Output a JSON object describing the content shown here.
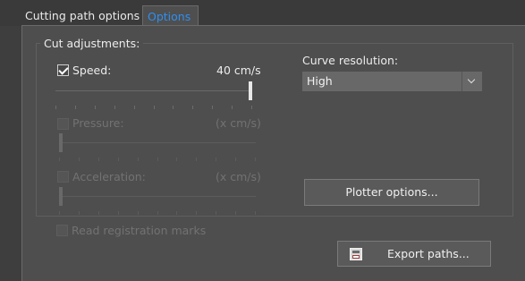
{
  "tabs": [
    {
      "label": "Cutting path options",
      "active": false
    },
    {
      "label": "Options",
      "active": true
    }
  ],
  "cut_adjustments": {
    "title": "Cut adjustments:",
    "speed": {
      "label": "Speed:",
      "value_text": "40 cm/s",
      "checked": true,
      "enabled": true,
      "slider_fraction": 1.0
    },
    "pressure": {
      "label": "Pressure:",
      "value_text": "(x cm/s)",
      "checked": false,
      "enabled": false,
      "slider_fraction": 0.0
    },
    "acceleration": {
      "label": "Acceleration:",
      "value_text": "(x cm/s)",
      "checked": false,
      "enabled": false,
      "slider_fraction": 0.0
    },
    "curve_resolution": {
      "label": "Curve resolution:",
      "selected": "High"
    },
    "plotter_options_label": "Plotter options..."
  },
  "read_registration_marks": {
    "label": "Read registration marks",
    "checked": false,
    "enabled": false
  },
  "export_paths": {
    "label": "Export paths...",
    "icon": "save-icon"
  },
  "colors": {
    "accent": "#2e8ff0",
    "panel": "#4e4e4e",
    "background": "#3e3e3e"
  }
}
